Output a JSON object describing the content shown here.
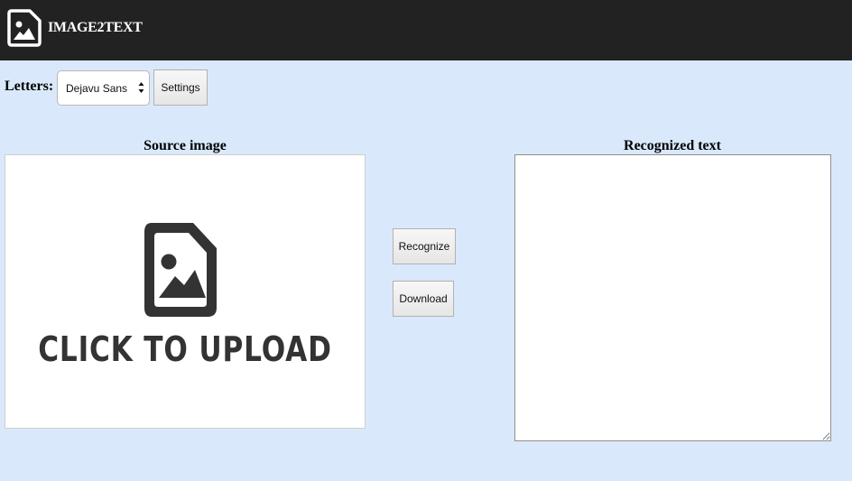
{
  "header": {
    "brand": "IMAGE2TEXT",
    "logo_icon": "image-file-icon"
  },
  "toolbar": {
    "letters_label": "Letters:",
    "font_select": {
      "selected": "Dejavu Sans"
    },
    "settings_label": "Settings"
  },
  "source": {
    "title": "Source image",
    "upload_icon": "image-file-icon",
    "upload_text": "CLICK TO UPLOAD"
  },
  "actions": {
    "recognize_label": "Recognize",
    "download_label": "Download"
  },
  "result": {
    "title": "Recognized text",
    "text": ""
  },
  "colors": {
    "header_bg": "#222222",
    "page_bg": "#d9e9fb",
    "icon_color": "#333333"
  }
}
